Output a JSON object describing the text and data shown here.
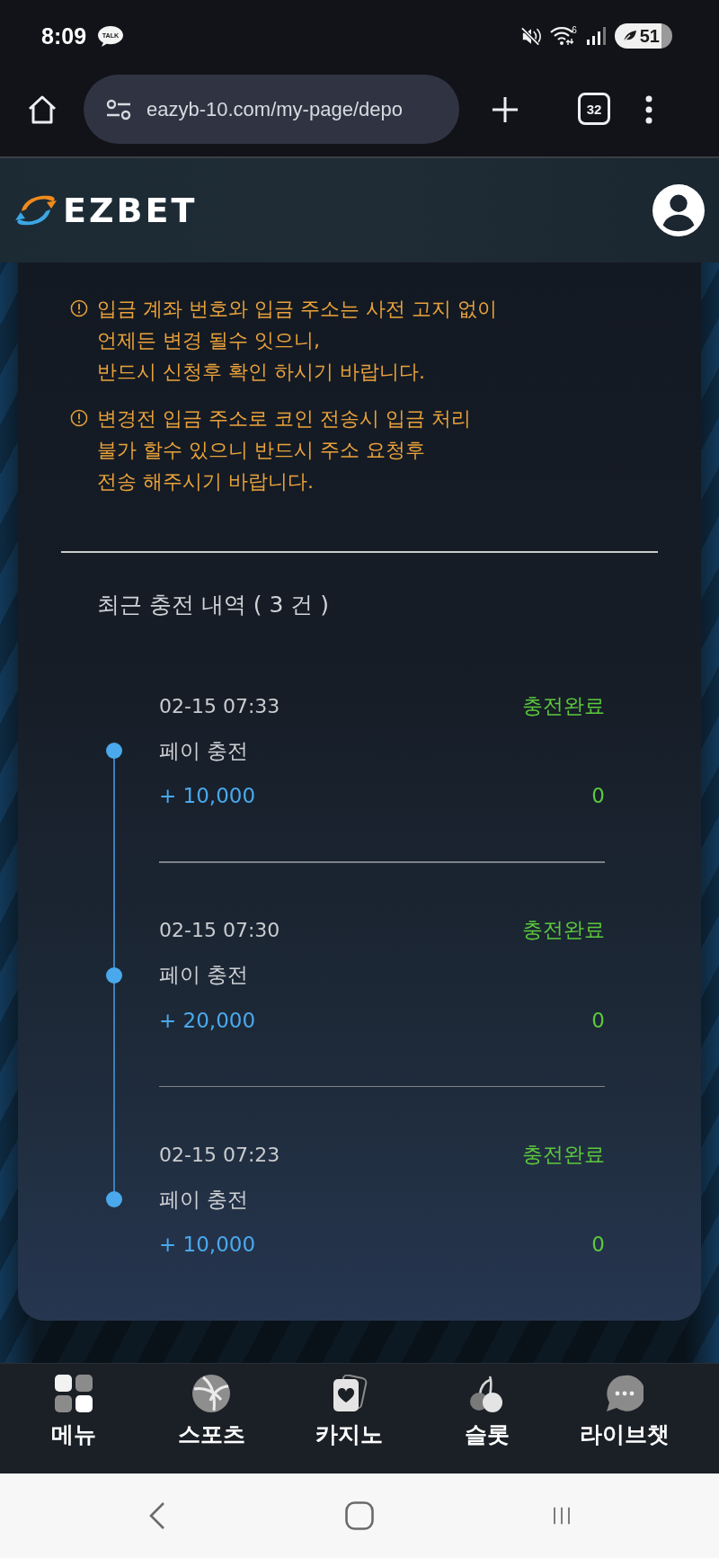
{
  "status_bar": {
    "time": "8:09",
    "notification_badge": "TALK",
    "wifi_label": "6",
    "battery": "51"
  },
  "browser": {
    "url": "eazyb-10.com/my-page/depo",
    "tab_count": "32"
  },
  "header": {
    "logo": "EZBET"
  },
  "notices": [
    {
      "lines": [
        "입금 계좌 번호와 입금 주소는 사전 고지 없이",
        "언제든 변경 될수 잇으니,",
        "반드시 신청후 확인 하시기 바랍니다."
      ]
    },
    {
      "lines": [
        "변경전 입금 주소로 코인 전송시 입금 처리",
        "불가 할수 있으니 반드시 주소 요청후",
        "전송 해주시기 바랍니다."
      ]
    }
  ],
  "history": {
    "title": "최근 충전 내역 ( 3 건 )",
    "items": [
      {
        "time": "02-15 07:33",
        "status": "충전완료",
        "type": "페이 충전",
        "amount": "+ 10,000",
        "bonus": "0"
      },
      {
        "time": "02-15 07:30",
        "status": "충전완료",
        "type": "페이 충전",
        "amount": "+ 20,000",
        "bonus": "0"
      },
      {
        "time": "02-15 07:23",
        "status": "충전완료",
        "type": "페이 충전",
        "amount": "+ 10,000",
        "bonus": "0"
      }
    ]
  },
  "bottom_nav": [
    {
      "label": "메뉴",
      "kind": "menu"
    },
    {
      "label": "스포츠",
      "kind": "sports"
    },
    {
      "label": "카지노",
      "kind": "casino"
    },
    {
      "label": "슬롯",
      "kind": "slot"
    },
    {
      "label": "라이브챗",
      "kind": "chat"
    }
  ]
}
